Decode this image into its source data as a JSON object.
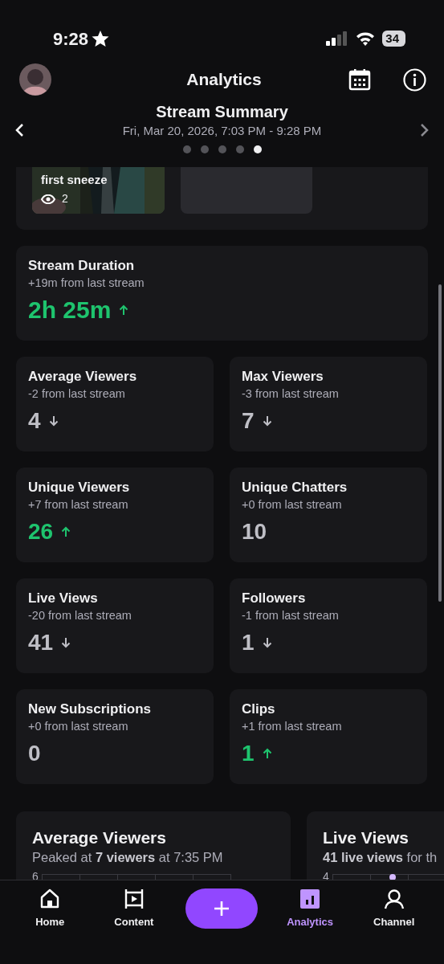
{
  "status_bar": {
    "time": "9:28",
    "battery": "34"
  },
  "header": {
    "title": "Analytics"
  },
  "summary": {
    "title": "Stream Summary",
    "date_range": "Fri, Mar 20, 2026, 7:03 PM - 9:28 PM",
    "pages": [
      {
        "selected": false
      },
      {
        "selected": false
      },
      {
        "selected": false
      },
      {
        "selected": false
      },
      {
        "selected": true
      }
    ]
  },
  "clip": {
    "kind": "picture",
    "title": "first sneeze",
    "views": "2"
  },
  "duration": {
    "title": "Stream Duration",
    "change": "+19m from last stream",
    "value": "2h 25m",
    "kind": "up"
  },
  "stats": [
    {
      "title": "Average Viewers",
      "change": "-2 from last stream",
      "value": "4",
      "kind": "down"
    },
    {
      "title": "Max Viewers",
      "change": "-3 from last stream",
      "value": "7",
      "kind": "down"
    },
    {
      "title": "Unique Viewers",
      "change": "+7 from last stream",
      "value": "26",
      "kind": "up"
    },
    {
      "title": "Unique Chatters",
      "change": "+0 from last stream",
      "value": "10",
      "kind": "flat"
    },
    {
      "title": "Live Views",
      "change": "-20 from last stream",
      "value": "41",
      "kind": "down"
    },
    {
      "title": "Followers",
      "change": "-1 from last stream",
      "value": "1",
      "kind": "down"
    },
    {
      "title": "New Subscriptions",
      "change": "+0 from last stream",
      "value": "0",
      "kind": "flat"
    },
    {
      "title": "Clips",
      "change": "+1 from last stream",
      "value": "1",
      "kind": "up"
    }
  ],
  "charts": [
    {
      "title": "Average Viewers",
      "subtitle": "Peaked at **7 viewers** at 7:35 PM",
      "axis_label": "6"
    },
    {
      "title": "Live Views",
      "subtitle": "**41 live views** for th",
      "axis_label": "4"
    }
  ],
  "tabs": [
    {
      "label": "Home",
      "kind": "home",
      "selected": false
    },
    {
      "label": "Content",
      "kind": "content",
      "selected": false
    },
    {
      "kind": "create",
      "selected": false
    },
    {
      "label": "Analytics",
      "kind": "analytics",
      "selected": true
    },
    {
      "label": "Channel",
      "kind": "channel",
      "selected": false
    }
  ]
}
